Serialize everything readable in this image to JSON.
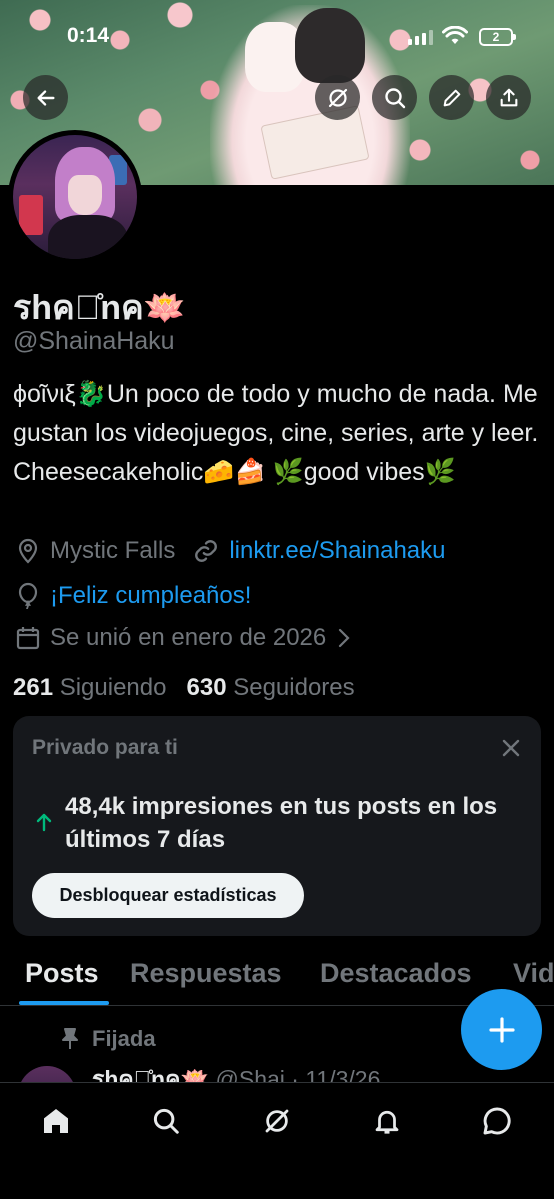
{
  "status_bar": {
    "time": "0:14",
    "battery": "2"
  },
  "header": {
    "back_icon": "arrow-left-icon",
    "actions": [
      "grok-icon",
      "search-icon",
      "edit-icon",
      "share-icon"
    ]
  },
  "profile": {
    "name": "รhคโ̊nค🪷",
    "handle": "@ShainaHaku",
    "bio": "ϕοῖνιξ🐉Un poco de todo y mucho de nada. Me gustan los videojuegos, cine, series, arte y leer. Cheesecakeholic🧀🍰 🌿good vibes🌿",
    "location": "Mystic Falls",
    "website": "linktr.ee/Shainahaku",
    "birthday": "¡Feliz cumpleaños!",
    "joined": "Se unió en enero de 2026",
    "following_count": "261",
    "following_label": "Siguiendo",
    "followers_count": "630",
    "followers_label": "Seguidores"
  },
  "private_card": {
    "title": "Privado para ti",
    "text": "48,4k impresiones en tus posts en los últimos 7 días",
    "button": "Desbloquear estadísticas",
    "accent": "#00ba7c"
  },
  "tabs": [
    "Posts",
    "Respuestas",
    "Destacados",
    "Vid"
  ],
  "pinned": {
    "label": "Fijada",
    "author": "รhคโ̊nค🪷",
    "handle": "@Shai",
    "date": "· 11/3/26"
  },
  "colors": {
    "accent": "#1d9bf0",
    "background": "#000000",
    "muted": "#71767b"
  },
  "bottom_nav": [
    "home-icon",
    "search-icon",
    "grok-icon",
    "notifications-icon",
    "messages-icon"
  ]
}
